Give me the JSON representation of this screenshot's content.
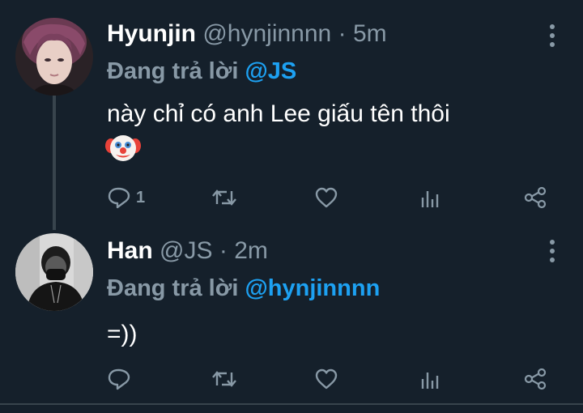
{
  "tweets": [
    {
      "display_name": "Hyunjin",
      "handle": "@hynjinnnn",
      "separator": "·",
      "time": "5m",
      "replying_prefix": "Đang trả lời",
      "replying_to": "@JS",
      "text": "này chỉ có anh Lee giấu tên thôi",
      "emoji_icon": "clown-face-icon",
      "reply_count": "1"
    },
    {
      "display_name": "Han",
      "handle": "@JS",
      "separator": "·",
      "time": "2m",
      "replying_prefix": "Đang trả lời",
      "replying_to": "@hynjinnnn",
      "text": "=))",
      "reply_count": ""
    }
  ],
  "colors": {
    "background": "#15202b",
    "primary_text": "#ffffff",
    "secondary_text": "#8899a6",
    "accent": "#1da1f2",
    "border": "#38444d"
  },
  "icons": {
    "reply": "reply-icon",
    "retweet": "retweet-icon",
    "like": "heart-icon",
    "stats": "stats-icon",
    "share": "share-icon",
    "more": "more-options-icon"
  }
}
